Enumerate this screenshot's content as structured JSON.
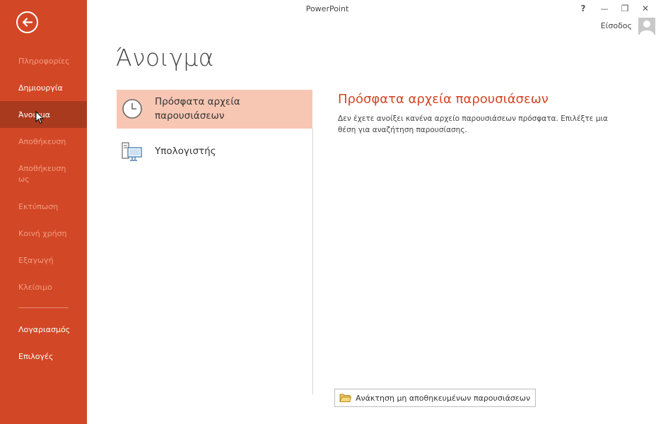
{
  "app": {
    "title": "PowerPoint",
    "signin": "Είσοδος"
  },
  "window_controls": {
    "help": "?",
    "minimize": "—",
    "restore": "❐",
    "close": "✕"
  },
  "sidebar": {
    "items": [
      {
        "label": "Πληροφορίες",
        "state": "disabled"
      },
      {
        "label": "Δημιουργία",
        "state": "enabled"
      },
      {
        "label": "Άνοιγμα",
        "state": "active"
      },
      {
        "label": "Αποθήκευση",
        "state": "disabled"
      },
      {
        "label": "Αποθήκευση ως",
        "state": "disabled"
      },
      {
        "label": "Εκτύπωση",
        "state": "disabled"
      },
      {
        "label": "Κοινή χρήση",
        "state": "disabled"
      },
      {
        "label": "Εξαγωγή",
        "state": "disabled"
      },
      {
        "label": "Κλείσιμο",
        "state": "disabled"
      },
      {
        "label": "Λογαριασμός",
        "state": "enabled"
      },
      {
        "label": "Επιλογές",
        "state": "enabled"
      }
    ]
  },
  "main": {
    "title": "Άνοιγμα",
    "places": [
      {
        "label": "Πρόσφατα αρχεία παρουσιάσεων",
        "icon": "clock-icon",
        "selected": true
      },
      {
        "label": "Υπολογιστής",
        "icon": "computer-icon",
        "selected": false
      }
    ],
    "recent": {
      "title": "Πρόσφατα αρχεία παρουσιάσεων",
      "description": "Δεν έχετε ανοίξει κανένα αρχείο παρουσιάσεων πρόσφατα. Επιλέξτε μια θέση για αναζήτηση παρουσίασης."
    },
    "recover_button": "Ανάκτηση μη αποθηκευμένων παρουσιάσεων"
  },
  "colors": {
    "accent": "#d24726",
    "sidebar_active": "#aa3a1e",
    "selected_place": "#f8c7b4",
    "disabled_text": "#f39c82"
  }
}
